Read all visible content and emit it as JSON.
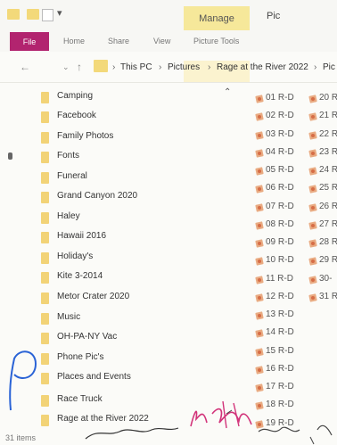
{
  "window": {
    "title": "Pic",
    "contextual_tab": "Manage",
    "contextual_subtab": "Picture Tools"
  },
  "ribbon": {
    "tabs": [
      "File",
      "Home",
      "Share",
      "View"
    ]
  },
  "address": {
    "crumbs": [
      "This PC",
      "Pictures",
      "Rage at the River 2022",
      "Pic"
    ]
  },
  "nav_pane": {
    "items": [
      "Camping",
      "Facebook",
      "Family Photos",
      "Fonts",
      "Funeral",
      "Grand Canyon 2020",
      "Haley",
      "Hawaii 2016",
      "Holiday's",
      "Kite 3-2014",
      "Metor Crater 2020",
      "Music",
      "OH-PA-NY Vac",
      "Phone Pic's",
      "Places and Events",
      "Race Truck",
      "Rage at the River 2022"
    ]
  },
  "files": {
    "column1": [
      "01 R-D",
      "02 R-D",
      "03 R-D",
      "04 R-D",
      "05 R-D",
      "06 R-D",
      "07 R-D",
      "08 R-D",
      "09 R-D",
      "10 R-D",
      "11 R-D",
      "12 R-D",
      "13 R-D",
      "14 R-D",
      "15 R-D",
      "16 R-D",
      "17 R-D",
      "18 R-D",
      "19 R-D"
    ],
    "column2": [
      "20 R",
      "21 R",
      "22 R",
      "23 R",
      "24 R",
      "25 R",
      "26 R",
      "27 R",
      "28 R",
      "29 R",
      "30-",
      "31 R"
    ]
  },
  "status": {
    "item_count": "31 items"
  },
  "colors": {
    "file_tab": "#b2246f",
    "manage_tab": "#f6e89a",
    "folder": "#f2d377",
    "ink_blue": "#2a63d6",
    "ink_pink": "#d2337a"
  }
}
